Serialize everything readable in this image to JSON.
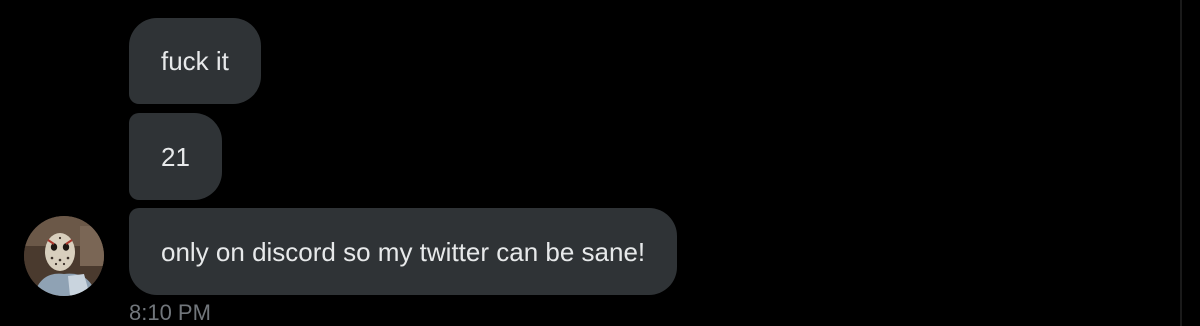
{
  "conversation": {
    "messages": [
      {
        "text": "fuck it"
      },
      {
        "text": "21"
      },
      {
        "text": "only on discord so my twitter can be sane!"
      }
    ],
    "timestamp": "8:10 PM"
  },
  "colors": {
    "background": "#000000",
    "bubble": "#2f3336",
    "bubble_text": "#e7e9ea",
    "timestamp": "#71767b"
  },
  "icons": {
    "avatar": "hockey-mask-avatar"
  }
}
